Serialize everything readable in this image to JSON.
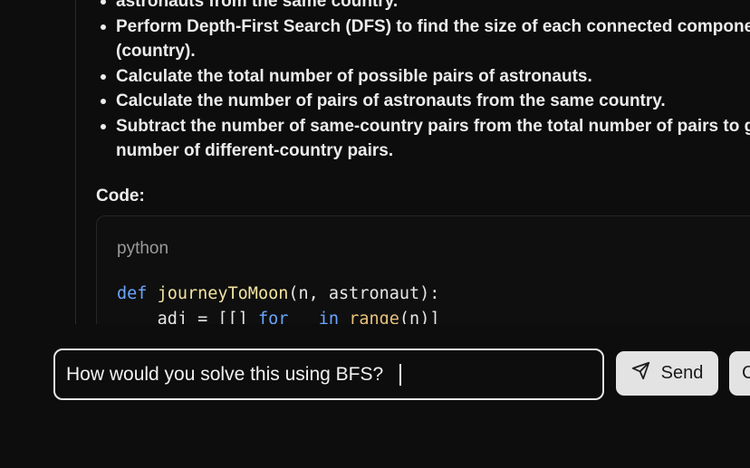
{
  "message": {
    "bullets": [
      {
        "line1": "astronauts from the same country.",
        "line2": ""
      },
      {
        "line1": "Perform Depth-First Search (DFS) to find the size of each connected component",
        "line2": "(country)."
      },
      {
        "line1": "Calculate the total number of possible pairs of astronauts.",
        "line2": ""
      },
      {
        "line1": "Calculate the number of pairs of astronauts from the same country.",
        "line2": ""
      },
      {
        "line1": "Subtract the number of same-country pairs from the total number of pairs to get the",
        "line2": "number of different-country pairs."
      }
    ],
    "code_heading": "Code:",
    "code": {
      "language": "python",
      "line1": {
        "kw": "def",
        "fn": "journeyToMoon",
        "rest": "(n, astronaut):"
      },
      "line2": {
        "indent": "    ",
        "a": "adj = [[] ",
        "kw1": "for",
        "b": " _ ",
        "kw2": "in",
        "c": " ",
        "bi": "range",
        "d": "(n)]"
      }
    }
  },
  "composer": {
    "value": "How would you solve this using BFS?",
    "placeholder": ""
  },
  "buttons": {
    "send_label": "Send",
    "send_icon": "send-icon",
    "extra_label": "C"
  }
}
